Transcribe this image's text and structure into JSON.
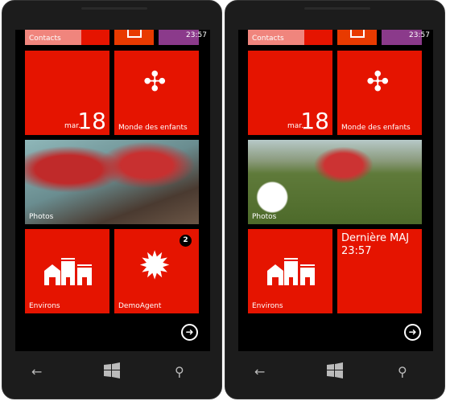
{
  "phones": [
    {
      "contacts": "Contacts",
      "status_time": "23:57",
      "date_day": "mar.",
      "date_num": "18",
      "kids": "Monde des enfants",
      "photos": "Photos",
      "environs": "Environs",
      "agent": "DemoAgent",
      "agent_badge": "2"
    },
    {
      "contacts": "Contacts",
      "status_time": "23:57",
      "date_day": "mar.",
      "date_num": "18",
      "kids": "Monde des enfants",
      "photos": "Photos",
      "environs": "Environs",
      "live_title": "Dernière MAJ",
      "live_time": "23:57"
    }
  ],
  "colors": {
    "accent": "#e51400",
    "office": "#e83a00",
    "purple": "#8b3a8b",
    "contacts_light": "#f0857d"
  }
}
